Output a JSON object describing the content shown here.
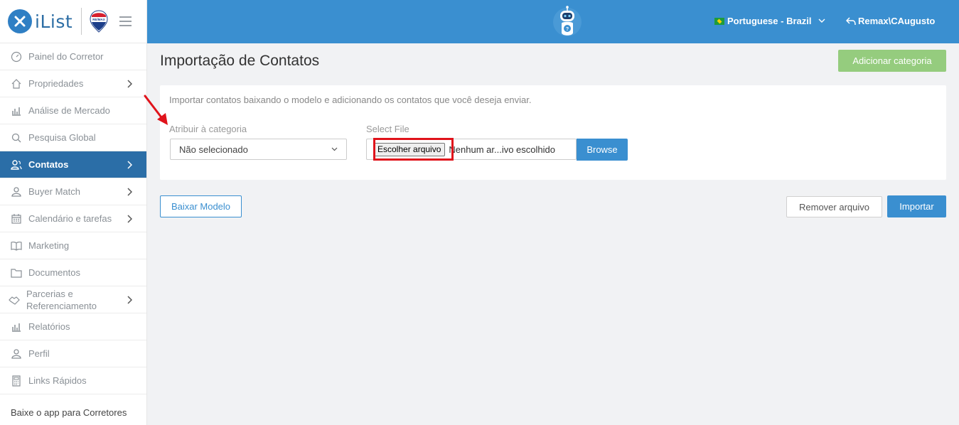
{
  "app": {
    "logo_text": "iList",
    "remax_logo": "RE/MAX"
  },
  "sidebar": {
    "items": [
      {
        "label": "Painel do Corretor",
        "icon": "gauge-icon",
        "chevron": false
      },
      {
        "label": "Propriedades",
        "icon": "home-icon",
        "chevron": true
      },
      {
        "label": "Análise de Mercado",
        "icon": "bar-chart-icon",
        "chevron": false
      },
      {
        "label": "Pesquisa Global",
        "icon": "search-icon",
        "chevron": false
      },
      {
        "label": "Contatos",
        "icon": "contacts-icon",
        "chevron": true,
        "active": true
      },
      {
        "label": "Buyer Match",
        "icon": "user-icon",
        "chevron": true
      },
      {
        "label": "Calendário e tarefas",
        "icon": "calendar-icon",
        "chevron": true
      },
      {
        "label": "Marketing",
        "icon": "book-icon",
        "chevron": false
      },
      {
        "label": "Documentos",
        "icon": "folder-icon",
        "chevron": false
      },
      {
        "label": "Parcerias e Referenciamento",
        "label_line1": "Parcerias e",
        "label_line2": "Referenciamento",
        "icon": "handshake-icon",
        "chevron": true
      },
      {
        "label": "Relatórios",
        "icon": "bar-chart-icon",
        "chevron": false
      },
      {
        "label": "Perfil",
        "icon": "user-icon",
        "chevron": false
      },
      {
        "label": "Links Rápidos",
        "icon": "calculator-icon",
        "chevron": false
      }
    ],
    "footer": "Baixe o app para Corretores"
  },
  "topbar": {
    "language": "Portuguese - Brazil",
    "user": "Remax\\CAugusto"
  },
  "main": {
    "title": "Importação de Contatos",
    "add_category_label": "Adicionar categoria",
    "description": "Importar contatos baixando o modelo e adicionando os contatos que você deseja enviar.",
    "category_label": "Atribuir à categoria",
    "category_value": "Não selecionado",
    "file_label": "Select File",
    "choose_file_label": "Escolher arquivo",
    "file_name": "Nenhum ar...ivo escolhido",
    "browse_label": "Browse",
    "download_template_label": "Baixar Modelo",
    "remove_file_label": "Remover arquivo",
    "import_label": "Importar"
  },
  "colors": {
    "primary": "#3a8fd0",
    "sidebar_active": "#2b6ea7",
    "add_button": "#95cc7e",
    "highlight": "#e0131b"
  }
}
